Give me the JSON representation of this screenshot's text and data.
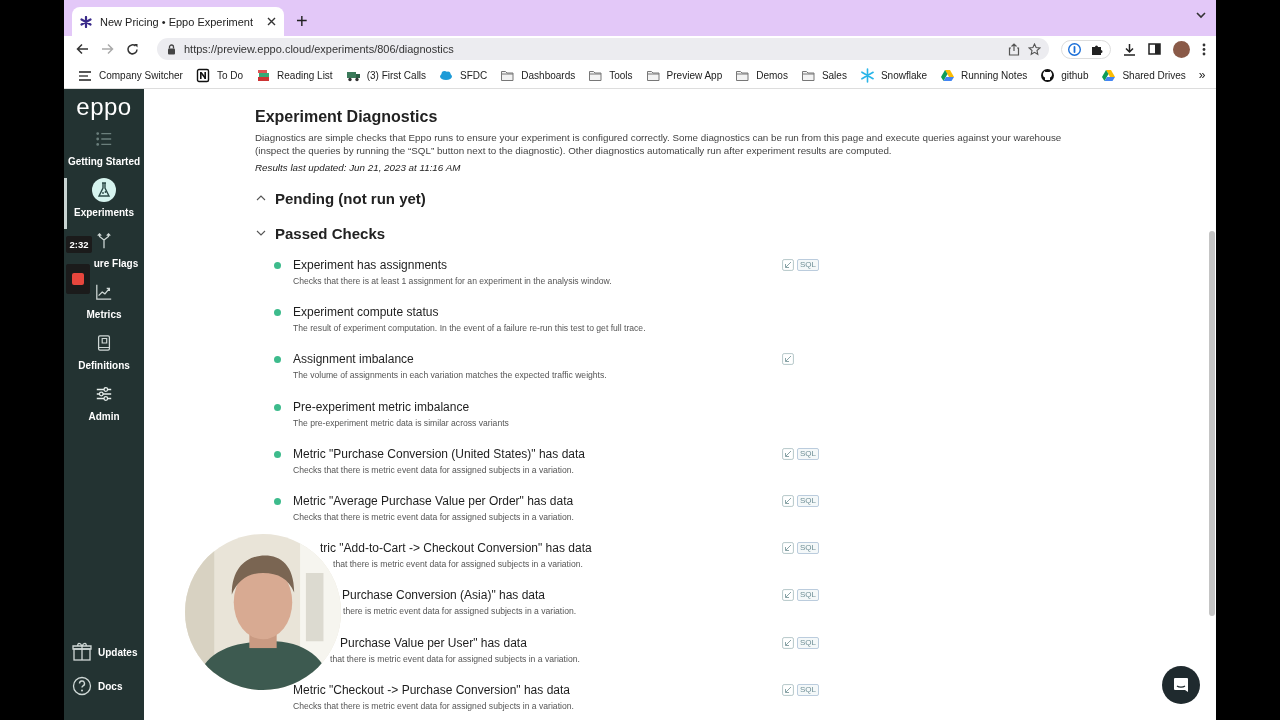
{
  "browser": {
    "tab": {
      "title": "New Pricing • Eppo Experiment",
      "selected": true
    },
    "new_tab": "+",
    "url": "https://preview.eppo.cloud/experiments/806/diagnostics",
    "bookmarks": [
      {
        "label": "Company Switcher"
      },
      {
        "label": "To Do"
      },
      {
        "label": "Reading List"
      },
      {
        "label": "(3) First Calls"
      },
      {
        "label": "SFDC"
      },
      {
        "label": "Dashboards"
      },
      {
        "label": "Tools"
      },
      {
        "label": "Preview App"
      },
      {
        "label": "Demos"
      },
      {
        "label": "Sales"
      },
      {
        "label": "Snowflake"
      },
      {
        "label": "Running Notes"
      },
      {
        "label": "github"
      },
      {
        "label": "Shared Drives"
      }
    ],
    "bookmarks_more": "»"
  },
  "sidebar": {
    "logo": "eppo",
    "items": [
      {
        "label": "Getting Started",
        "selected": false,
        "covered": false
      },
      {
        "label": "Experiments",
        "selected": true,
        "covered": false
      },
      {
        "label": "ure Flags",
        "selected": false,
        "covered": true
      },
      {
        "label": "Metrics",
        "selected": false,
        "covered": false
      },
      {
        "label": "Definitions",
        "selected": false,
        "covered": false
      },
      {
        "label": "Admin",
        "selected": false,
        "covered": false
      }
    ],
    "footer": [
      {
        "label": "Updates"
      },
      {
        "label": "Docs"
      }
    ]
  },
  "recorder": {
    "timer": "2:32"
  },
  "page": {
    "title": "Experiment Diagnostics",
    "description": "Diagnostics are simple checks that Eppo runs to ensure your experiment is configured correctly. Some diagnostics can be run from this page and execute queries against your warehouse (inspect the queries by running the “SQL” button next to the diagnostic). Other diagnostics automatically run after experiment results are computed.",
    "updated": "Results last updated: Jun 21, 2023 at 11:16 AM",
    "sections": [
      {
        "title": "Pending (not run yet)",
        "expanded": false
      },
      {
        "title": "Passed Checks",
        "expanded": true,
        "checks": [
          {
            "title": "Experiment has assignments",
            "description": "Checks that there is at least 1 assignment for an experiment in the analysis window.",
            "passed": true,
            "covered": false,
            "runnable": true,
            "sql": "SQL"
          },
          {
            "title": "Experiment compute status",
            "description": "The result of experiment computation. In the event of a failure re-run this test to get full trace.",
            "passed": true,
            "covered": false,
            "runnable": false
          },
          {
            "title": "Assignment imbalance",
            "description": "The volume of assignments in each variation matches the expected traffic weights.",
            "passed": true,
            "covered": false,
            "runnable": true
          },
          {
            "title": "Pre-experiment metric imbalance",
            "description": "The pre-experiment metric data is similar across variants",
            "passed": true,
            "covered": false,
            "runnable": false
          },
          {
            "title": "Metric \"Purchase Conversion (United States)\" has data",
            "description": "Checks that there is metric event data for assigned subjects in a variation.",
            "passed": true,
            "covered": false,
            "runnable": true,
            "sql": "SQL"
          },
          {
            "title": "Metric \"Average Purchase Value per Order\" has data",
            "description": "Checks that there is metric event data for assigned subjects in a variation.",
            "passed": true,
            "covered": false,
            "runnable": true,
            "sql": "SQL"
          },
          {
            "title": "tric \"Add-to-Cart -> Checkout Conversion\" has data",
            "description": "that there is metric event data for assigned subjects in a variation.",
            "covered": true,
            "runnable": true,
            "sql": "SQL"
          },
          {
            "title": "Purchase Conversion (Asia)\" has data",
            "description": "there is metric event data for assigned subjects in a variation.",
            "covered": true,
            "runnable": true,
            "sql": "SQL"
          },
          {
            "title": "Purchase Value per User\" has data",
            "description": "that there is metric event data for assigned subjects in a variation.",
            "covered": true,
            "runnable": true,
            "sql": "SQL"
          },
          {
            "title": "Metric \"Checkout -> Purchase Conversion\" has data",
            "description": "Checks that there is metric event data for assigned subjects in a variation.",
            "covered": true,
            "runnable": true,
            "sql": "SQL"
          }
        ]
      }
    ]
  }
}
